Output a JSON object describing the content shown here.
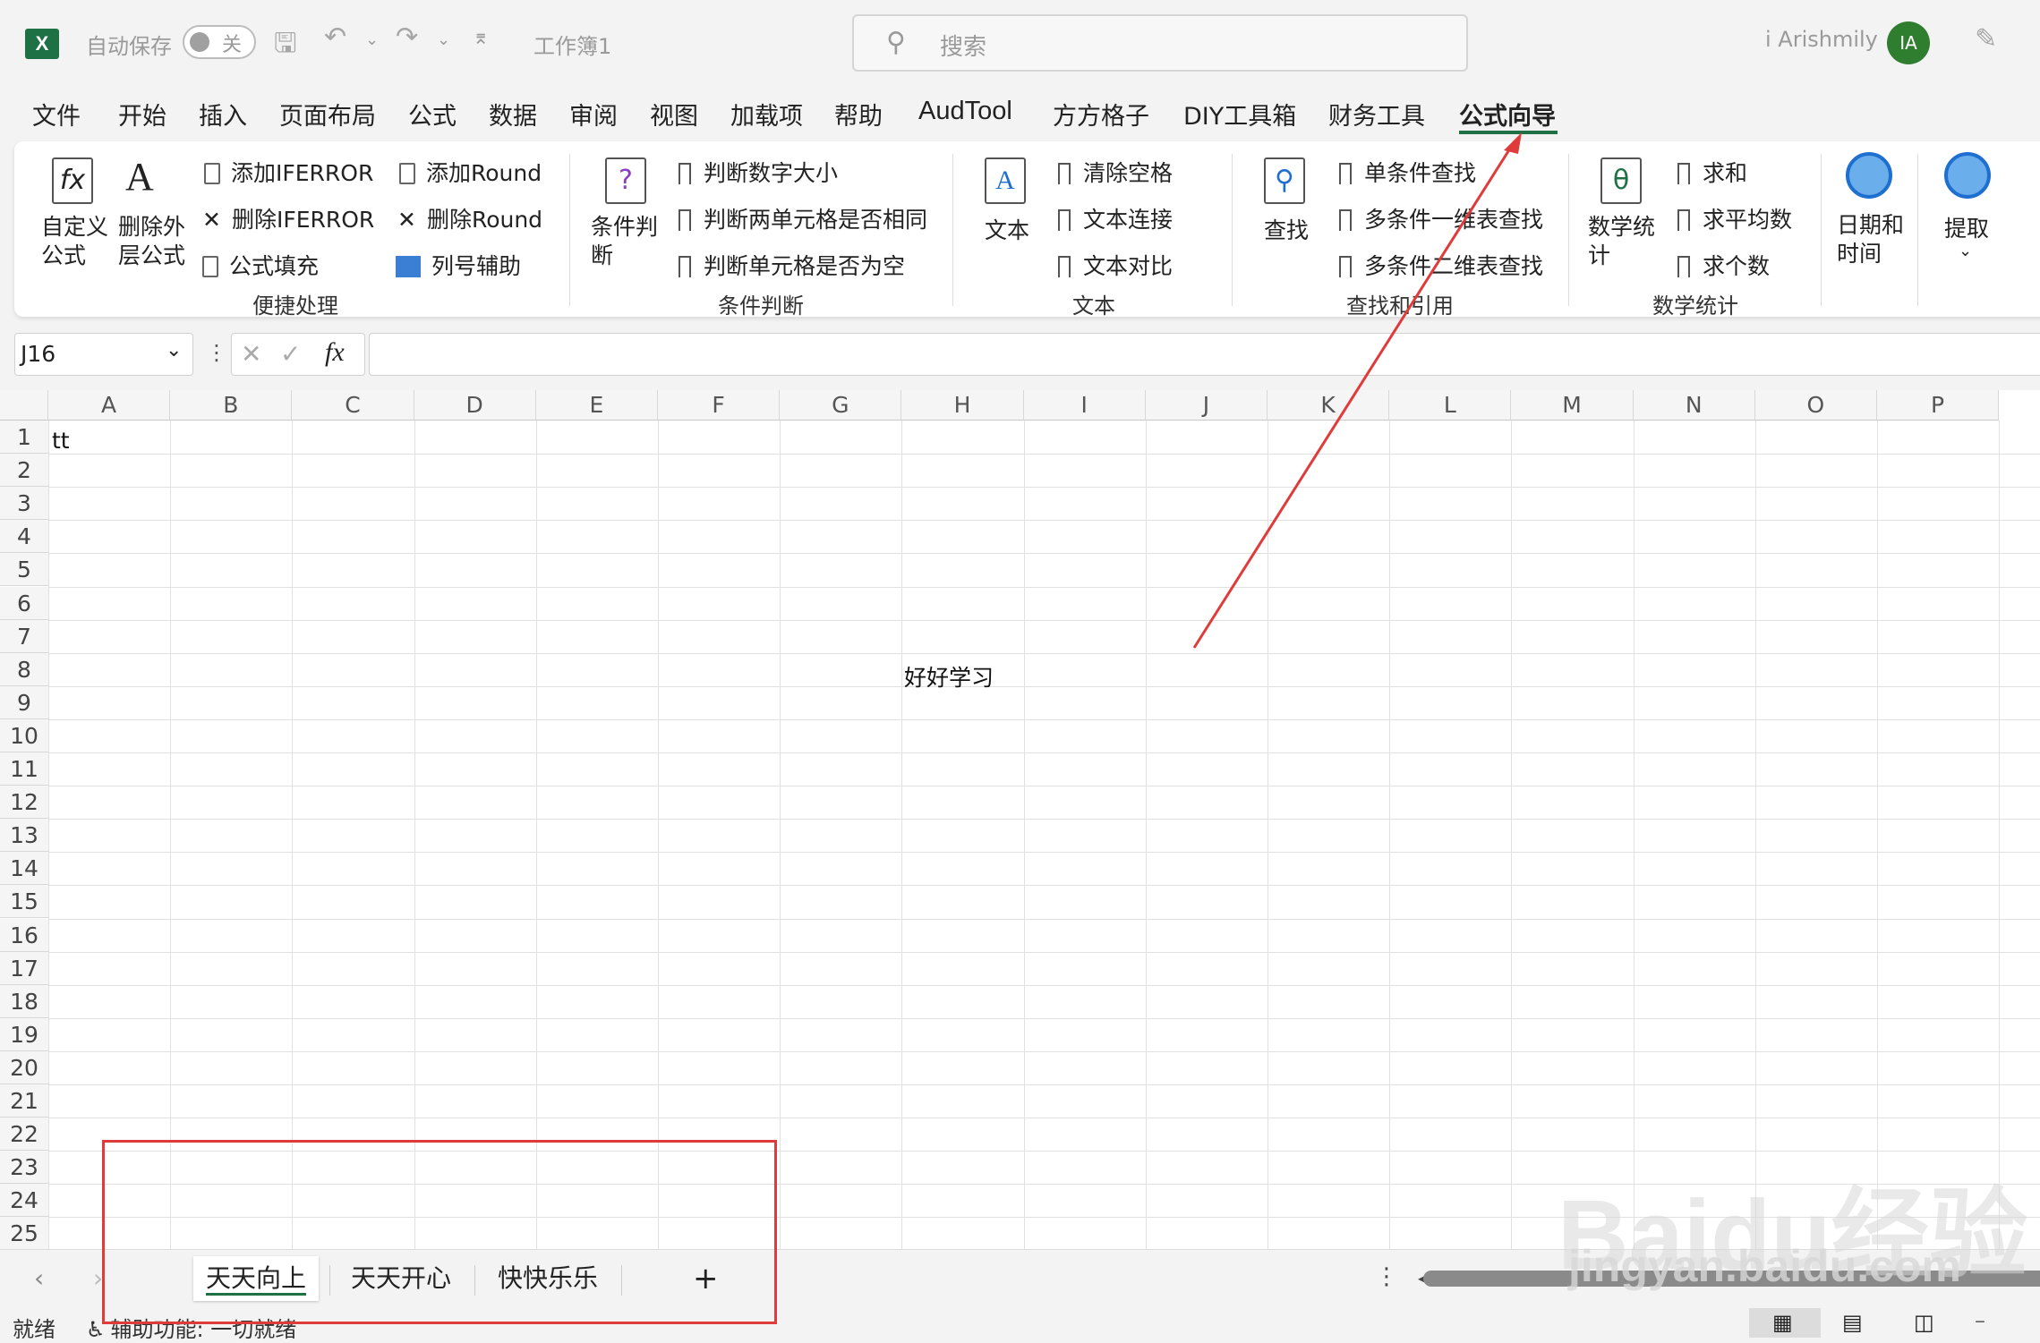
{
  "titlebar": {
    "autosave_label": "自动保存",
    "autosave_state": "关",
    "workbook_name": "工作簿1",
    "search_placeholder": "搜索",
    "user_name": "i Arishmily",
    "avatar_initials": "IA"
  },
  "menu": {
    "tabs": [
      "文件",
      "开始",
      "插入",
      "页面布局",
      "公式",
      "数据",
      "审阅",
      "视图",
      "加载项",
      "帮助",
      "AudTool",
      "方方格子",
      "DIY工具箱",
      "财务工具",
      "公式向导"
    ],
    "active_tab": "公式向导"
  },
  "ribbon": {
    "groups": {
      "quick": {
        "label": "便捷处理",
        "custom_formula": "自定义\n公式",
        "delete_outer": "删除外\n层公式",
        "add_iferror": "添加IFERROR",
        "del_iferror": "删除IFERROR",
        "fill_formula": "公式填充",
        "add_round": "添加Round",
        "del_round": "删除Round",
        "col_helper": "列号辅助"
      },
      "condition": {
        "label": "条件判断",
        "big": "条件判\n断",
        "items": [
          "判断数字大小",
          "判断两单元格是否相同",
          "判断单元格是否为空"
        ]
      },
      "text": {
        "label": "文本",
        "big": "文本",
        "items": [
          "清除空格",
          "文本连接",
          "文本对比"
        ]
      },
      "lookup": {
        "label": "查找和引用",
        "big": "查找",
        "items": [
          "单条件查找",
          "多条件一维表查找",
          "多条件二维表查找"
        ]
      },
      "math": {
        "label": "数学统计",
        "big": "数学统\n计",
        "items": [
          "求和",
          "求平均数",
          "求个数"
        ]
      },
      "datetime": {
        "big": "日期和\n时间"
      },
      "extract": {
        "big": "提取"
      }
    }
  },
  "formula_bar": {
    "name_box": "J16",
    "fx": "fx",
    "formula": ""
  },
  "grid": {
    "columns": [
      "A",
      "B",
      "C",
      "D",
      "E",
      "F",
      "G",
      "H",
      "I",
      "J",
      "K",
      "L",
      "M",
      "N",
      "O",
      "P"
    ],
    "rows": [
      "1",
      "2",
      "3",
      "4",
      "5",
      "6",
      "7",
      "8",
      "9",
      "10",
      "11",
      "12",
      "13",
      "14",
      "15",
      "16",
      "17",
      "18",
      "19",
      "20",
      "21",
      "22",
      "23",
      "24",
      "25"
    ],
    "cells": {
      "A1": "tt",
      "H8": "好好学习"
    }
  },
  "sheets": {
    "tabs": [
      "天天向上",
      "天天开心",
      "快快乐乐"
    ],
    "active": "天天向上",
    "add": "+"
  },
  "status": {
    "ready": "就绪",
    "accessibility": "辅助功能: 一切就绪"
  },
  "watermark": {
    "brand": "Baidu经验",
    "url": "jingyan.baidu.com"
  },
  "colors": {
    "excel_green": "#1e7145",
    "annotation_red": "#e03b3b"
  }
}
